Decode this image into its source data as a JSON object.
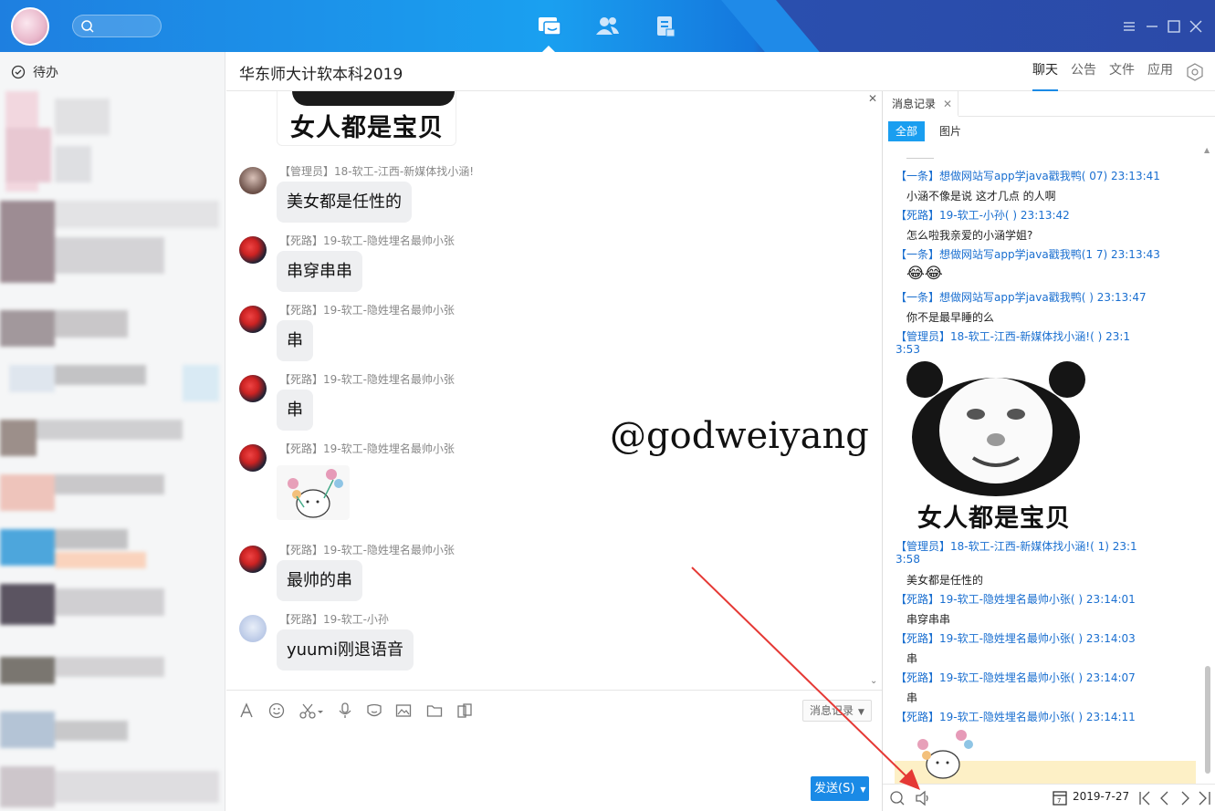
{
  "header": {
    "group_title": "华东师大计软本科2019",
    "tabs": [
      {
        "label": "聊天",
        "active": true
      },
      {
        "label": "公告"
      },
      {
        "label": "文件"
      },
      {
        "label": "应用"
      }
    ]
  },
  "sidebar": {
    "todo_label": "待办"
  },
  "chat": {
    "top_sticker_text": "女人都是宝贝",
    "messages": [
      {
        "sender": "【管理员】18-软工-江西-新媒体找小涵!",
        "text": "美女都是任性的"
      },
      {
        "sender": "【死路】19-软工-隐姓埋名最帅小张",
        "text": "串穿串串"
      },
      {
        "sender": "【死路】19-软工-隐姓埋名最帅小张",
        "text": "串"
      },
      {
        "sender": "【死路】19-软工-隐姓埋名最帅小张",
        "text": "串"
      },
      {
        "sender": "【死路】19-软工-隐姓埋名最帅小张",
        "text": ""
      },
      {
        "sender": "【死路】19-软工-隐姓埋名最帅小张",
        "text": "最帅的串"
      },
      {
        "sender": "【死路】19-软工-小孙",
        "text": "yuumi刚退语音"
      }
    ],
    "watermark": "@godweiyang"
  },
  "composer": {
    "history_label": "消息记录",
    "send_label": "发送(S)"
  },
  "history": {
    "tab_label": "消息记录",
    "filters": [
      "全部",
      "图片"
    ],
    "rows": [
      {
        "t": "s",
        "text": "【一条】想做网站写app学java戳我鸭(          07) 23:13:41"
      },
      {
        "t": "m",
        "text": "小涵不像是说 这才几点 的人啊"
      },
      {
        "t": "s",
        "text": "【死路】19-软工-小孙(          ) 23:13:42"
      },
      {
        "t": "m",
        "text": "怎么啦我亲爱的小涵学姐?"
      },
      {
        "t": "s",
        "text": "【一条】想做网站写app学java戳我鸭(1         7) 23:13:43"
      },
      {
        "t": "m",
        "text": "😂😂"
      },
      {
        "t": "s",
        "text": "【一条】想做网站写app学java戳我鸭(            ) 23:13:47"
      },
      {
        "t": "m",
        "text": "你不是最早睡的么"
      },
      {
        "t": "s",
        "text": "【管理员】18-软工-江西-新媒体找小涵!(          ) 23:1"
      },
      {
        "t": "s",
        "text": "3:53"
      },
      {
        "t": "s",
        "text": "【管理员】18-软工-江西-新媒体找小涵!(          1) 23:1"
      },
      {
        "t": "s",
        "text": "3:58"
      },
      {
        "t": "m",
        "text": "美女都是任性的"
      },
      {
        "t": "s",
        "text": "【死路】19-软工-隐姓埋名最帅小张(          ) 23:14:01"
      },
      {
        "t": "m",
        "text": "串穿串串"
      },
      {
        "t": "s",
        "text": "【死路】19-软工-隐姓埋名最帅小张(          ) 23:14:03"
      },
      {
        "t": "m",
        "text": "串"
      },
      {
        "t": "s",
        "text": "【死路】19-软工-隐姓埋名最帅小张(          ) 23:14:07"
      },
      {
        "t": "m",
        "text": "串"
      },
      {
        "t": "s",
        "text": "【死路】19-软工-隐姓埋名最帅小张(          ) 23:14:11"
      }
    ],
    "panda_text": "女人都是宝贝",
    "date": "2019-7-27"
  }
}
